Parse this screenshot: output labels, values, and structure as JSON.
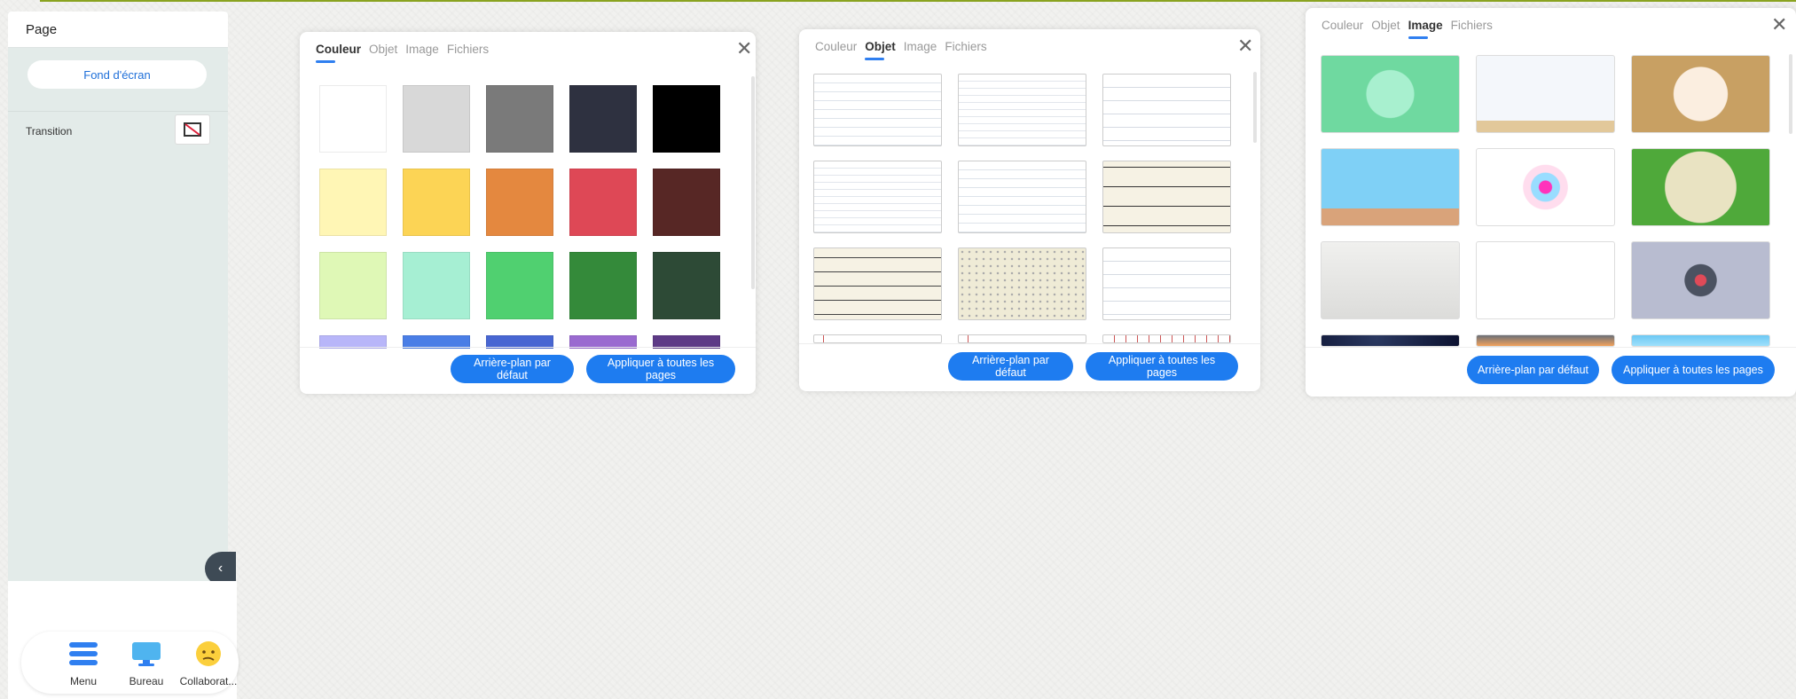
{
  "left_panel": {
    "title": "Page",
    "wallpaper_button": "Fond d'écran",
    "transition_label": "Transition",
    "collapse_glyph": "‹"
  },
  "dock": {
    "items": [
      {
        "label": "Menu",
        "icon": "menu-icon"
      },
      {
        "label": "Bureau",
        "icon": "monitor-icon"
      },
      {
        "label": "Collaborat...",
        "icon": "emoji-icon"
      }
    ]
  },
  "panels": [
    {
      "tabs": [
        "Couleur",
        "Objet",
        "Image",
        "Fichiers"
      ],
      "active_tab": "Couleur",
      "buttons": [
        "Arrière-plan par défaut",
        "Appliquer à toutes les pages"
      ],
      "colors": [
        "#ffffff",
        "#d8d8d8",
        "#7a7a7a",
        "#2e3140",
        "#000000",
        "#fff6b5",
        "#fcd455",
        "#e4883f",
        "#de4856",
        "#572725",
        "#dff8b6",
        "#a6efd3",
        "#50d070",
        "#348a3a",
        "#2d4a36",
        "#b8b6f9",
        "#4a7ee6",
        "#4866d2",
        "#9a6ad0",
        "#5d3a86"
      ]
    },
    {
      "tabs": [
        "Couleur",
        "Objet",
        "Image",
        "Fichiers"
      ],
      "active_tab": "Objet",
      "buttons": [
        "Arrière-plan par défaut",
        "Appliquer à toutes les pages"
      ],
      "patterns": [
        "lined",
        "grid",
        "wide-lined",
        "grid",
        "lined",
        "music-sheet",
        "staff-lines",
        "dotted-grid",
        "wide-lined",
        "margin",
        "margin",
        "calendar"
      ]
    },
    {
      "tabs": [
        "Couleur",
        "Objet",
        "Image",
        "Fichiers"
      ],
      "active_tab": "Image",
      "buttons": [
        "Arrière-plan par défaut",
        "Appliquer à toutes les pages"
      ],
      "images": [
        "green-classroom",
        "white-room",
        "sun-landscape",
        "sky-clouds",
        "colorful-flower",
        "green-map",
        "misty-branch",
        "blackboard",
        "grey-button",
        "dark-space",
        "orange-board",
        "blue-sky"
      ]
    }
  ]
}
